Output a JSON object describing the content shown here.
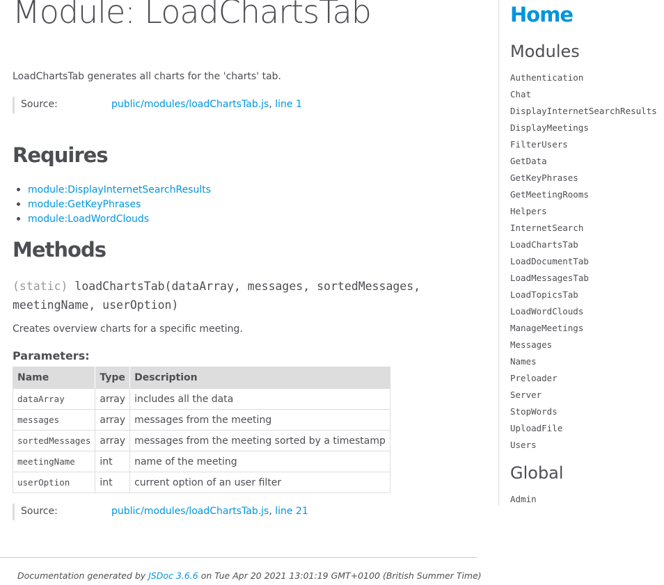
{
  "page": {
    "title": "Module: LoadChartsTab",
    "description": "LoadChartsTab generates all charts for the 'charts' tab.",
    "source_label": "Source:",
    "source_file": "public/modules/loadChartsTab.js",
    "source_sep": ", ",
    "source_line": "line 1"
  },
  "requires": {
    "heading": "Requires",
    "items": [
      "module:DisplayInternetSearchResults",
      "module:GetKeyPhrases",
      "module:LoadWordClouds"
    ]
  },
  "methods": {
    "heading": "Methods",
    "attrib": "(static)",
    "signature": "loadChartsTab(dataArray, messages, sortedMessages, meetingName, userOption)",
    "description": "Creates overview charts for a specific meeting.",
    "params_title": "Parameters:",
    "columns": [
      "Name",
      "Type",
      "Description"
    ],
    "params": [
      {
        "name": "dataArray",
        "type": "array",
        "description": "includes all the data"
      },
      {
        "name": "messages",
        "type": "array",
        "description": "messages from the meeting"
      },
      {
        "name": "sortedMessages",
        "type": "array",
        "description": "messages from the meeting sorted by a timestamp"
      },
      {
        "name": "meetingName",
        "type": "int",
        "description": "name of the meeting"
      },
      {
        "name": "userOption",
        "type": "int",
        "description": "current option of an user filter"
      }
    ],
    "source_label": "Source:",
    "source_file": "public/modules/loadChartsTab.js",
    "source_sep": ", ",
    "source_line": "line 21"
  },
  "footer": {
    "prefix": "Documentation generated by ",
    "link": "JSDoc 3.6.6",
    "suffix": " on Tue Apr 20 2021 13:01:19 GMT+0100 (British Summer Time)"
  },
  "nav": {
    "home": "Home",
    "modules_heading": "Modules",
    "modules": [
      "Authentication",
      "Chat",
      "DisplayInternetSearchResults",
      "DisplayMeetings",
      "FilterUsers",
      "GetData",
      "GetKeyPhrases",
      "GetMeetingRooms",
      "Helpers",
      "InternetSearch",
      "LoadChartsTab",
      "LoadDocumentTab",
      "LoadMessagesTab",
      "LoadTopicsTab",
      "LoadWordClouds",
      "ManageMeetings",
      "Messages",
      "Names",
      "Preloader",
      "Server",
      "StopWords",
      "UploadFile",
      "Users"
    ],
    "global_heading": "Global",
    "global": [
      "Admin"
    ]
  },
  "colors": {
    "link": "#0095dd",
    "text": "#4d4e53",
    "table_header_bg": "#dddddd"
  }
}
